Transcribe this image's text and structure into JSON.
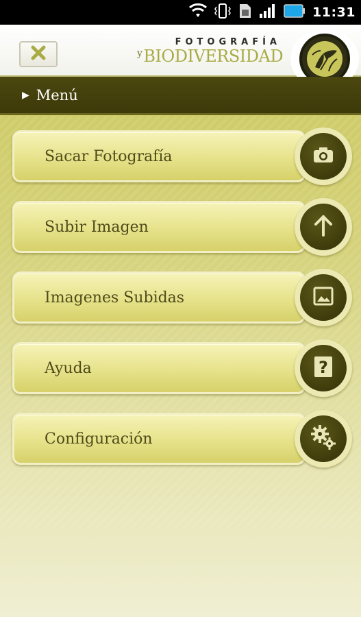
{
  "status_bar": {
    "time": "11:31",
    "icons": [
      "wifi-icon",
      "vibrate-icon",
      "sim-icon",
      "signal-icon",
      "battery-icon"
    ]
  },
  "header": {
    "close_icon": "close-icon",
    "logo": {
      "line1": "FOTOGRAFÍA",
      "connector": "y",
      "line2": "BIODIVERSIDAD"
    }
  },
  "menu_bar": {
    "title": "Menú"
  },
  "menu": {
    "items": [
      {
        "label": "Sacar Fotografía",
        "icon": "camera-icon"
      },
      {
        "label": "Subir Imagen",
        "icon": "upload-arrow-icon"
      },
      {
        "label": "Imagenes Subidas",
        "icon": "image-gallery-icon"
      },
      {
        "label": "Ayuda",
        "icon": "help-icon"
      },
      {
        "label": "Configuración",
        "icon": "settings-gears-icon"
      }
    ]
  },
  "colors": {
    "accent_dark": "#3f3c0c",
    "accent_light": "#e6e28a",
    "logo_green": "#a9ab46"
  }
}
